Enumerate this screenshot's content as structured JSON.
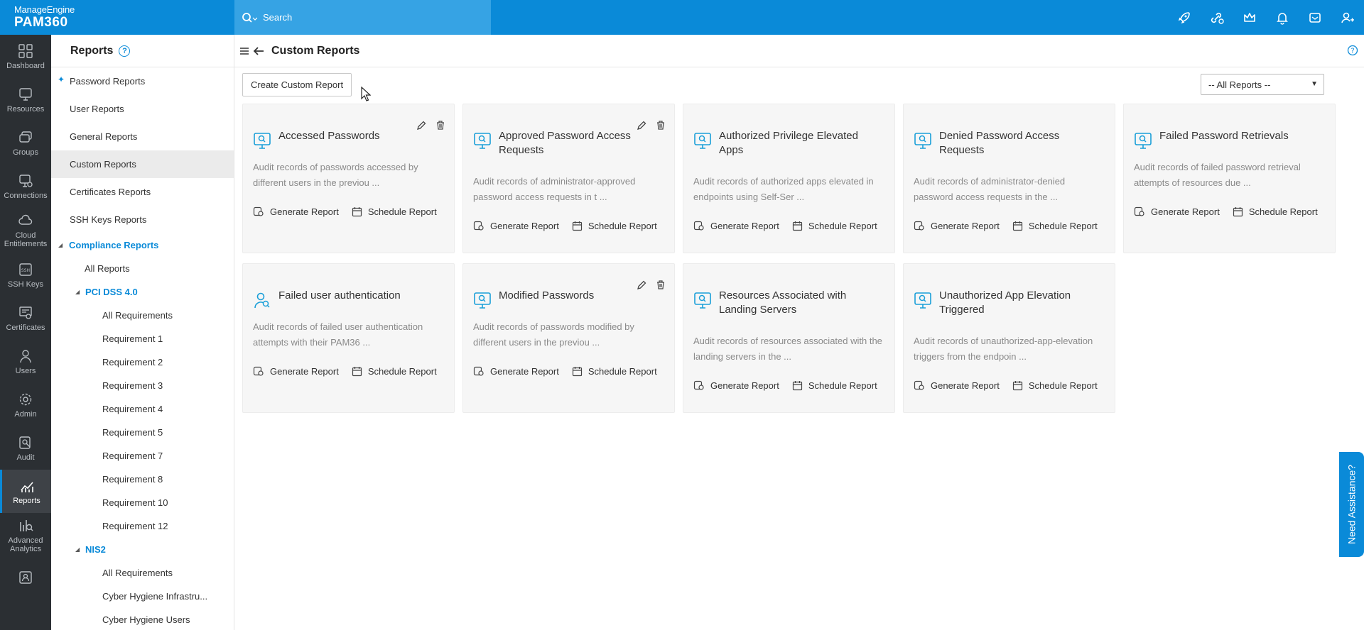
{
  "topbar": {
    "brand_top": "ManageEngine",
    "brand_product": "PAM360",
    "search_placeholder": "Search",
    "icons": [
      "rocket-icon",
      "link-settings-icon",
      "crown-icon",
      "bell-icon",
      "mail-icon",
      "user-settings-icon"
    ]
  },
  "leftnav": {
    "items": [
      {
        "label": "Dashboard",
        "icon": "dashboard-icon"
      },
      {
        "label": "Resources",
        "icon": "resources-icon"
      },
      {
        "label": "Groups",
        "icon": "groups-icon"
      },
      {
        "label": "Connections",
        "icon": "connections-icon"
      },
      {
        "label": "Cloud Entitlements",
        "icon": "cloud-icon"
      },
      {
        "label": "SSH Keys",
        "icon": "ssh-icon"
      },
      {
        "label": "Certificates",
        "icon": "certificate-icon"
      },
      {
        "label": "Users",
        "icon": "users-icon"
      },
      {
        "label": "Admin",
        "icon": "admin-icon"
      },
      {
        "label": "Audit",
        "icon": "audit-icon"
      },
      {
        "label": "Reports",
        "icon": "reports-icon"
      },
      {
        "label": "Advanced Analytics",
        "icon": "analytics-icon"
      },
      {
        "label": "",
        "icon": "contact-icon"
      }
    ]
  },
  "subnav": {
    "title": "Reports",
    "items": [
      "Password Reports",
      "User Reports",
      "General Reports",
      "Custom Reports",
      "Certificates Reports",
      "SSH Keys Reports"
    ],
    "compliance": {
      "label": "Compliance Reports",
      "all_reports": "All Reports",
      "pci": {
        "label": "PCI DSS 4.0",
        "items": [
          "All Requirements",
          "Requirement 1",
          "Requirement 2",
          "Requirement 3",
          "Requirement 4",
          "Requirement 5",
          "Requirement 7",
          "Requirement 8",
          "Requirement 10",
          "Requirement 12"
        ]
      },
      "nis2": {
        "label": "NIS2",
        "items": [
          "All Requirements",
          "Cyber Hygiene Infrastru...",
          "Cyber Hygiene Users"
        ]
      }
    }
  },
  "main": {
    "title": "Custom Reports",
    "create_button": "Create Custom Report",
    "filter_selected": "-- All Reports --",
    "generate_label": "Generate Report",
    "schedule_label": "Schedule Report",
    "cards": [
      {
        "title": "Accessed Passwords",
        "desc": "Audit records of passwords accessed by different users in the previou ...",
        "editable": true,
        "icon": "monitor-search-icon"
      },
      {
        "title": "Approved Password Access Requests",
        "desc": "Audit records of administrator-approved password access requests in t ...",
        "editable": true,
        "icon": "monitor-search-icon"
      },
      {
        "title": "Authorized Privilege Elevated Apps",
        "desc": "Audit records of authorized apps elevated in endpoints using Self-Ser ...",
        "editable": false,
        "icon": "monitor-search-icon"
      },
      {
        "title": "Denied Password Access Requests",
        "desc": "Audit records of administrator-denied password access requests in the ...",
        "editable": false,
        "icon": "monitor-search-icon"
      },
      {
        "title": "Failed Password Retrievals",
        "desc": "Audit records of failed password retrieval attempts of resources due ...",
        "editable": false,
        "icon": "monitor-search-icon"
      },
      {
        "title": "Failed user authentication",
        "desc": "Audit records of failed user authentication attempts with their PAM36 ...",
        "editable": false,
        "icon": "user-search-icon"
      },
      {
        "title": "Modified Passwords",
        "desc": "Audit records of passwords modified by different users in the previou ...",
        "editable": true,
        "icon": "monitor-search-icon"
      },
      {
        "title": "Resources Associated with Landing Servers",
        "desc": "Audit records of resources associated with the landing servers in the ...",
        "editable": false,
        "icon": "monitor-search-icon"
      },
      {
        "title": "Unauthorized App Elevation Triggered",
        "desc": "Audit records of unauthorized-app-elevation triggers from the endpoin ...",
        "editable": false,
        "icon": "monitor-search-icon"
      }
    ]
  },
  "assist_label": "Need Assistance?"
}
